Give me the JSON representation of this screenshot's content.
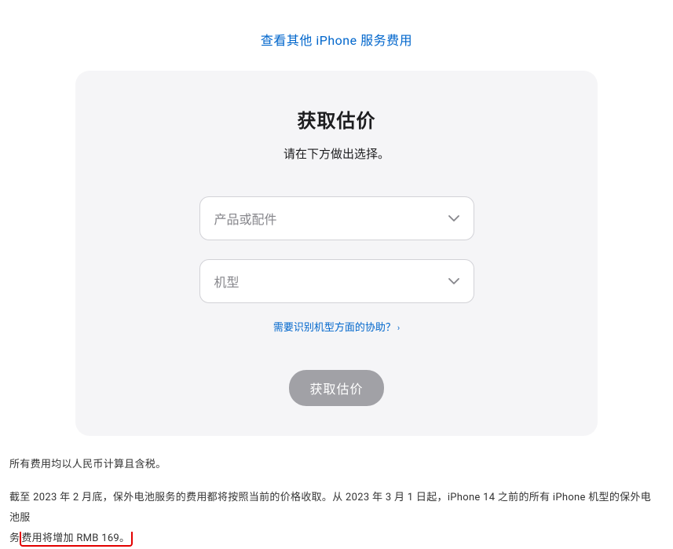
{
  "topLink": {
    "label": "查看其他 iPhone 服务费用"
  },
  "card": {
    "title": "获取估价",
    "subtitle": "请在下方做出选择。",
    "select1": {
      "placeholder": "产品或配件"
    },
    "select2": {
      "placeholder": "机型"
    },
    "helpLink": {
      "label": "需要识别机型方面的协助？"
    },
    "submitButton": {
      "label": "获取估价"
    }
  },
  "footer": {
    "line1": "所有费用均以人民币计算且含税。",
    "line2_part1": "截至 2023 年 2 月底，保外电池服务的费用都将按照当前的价格收取。从 2023 年 3 月 1 日起，iPhone 14 之前的所有 iPhone 机型的保外电池服",
    "line2_part2_prefix": "务",
    "line2_highlighted": "费用将增加 RMB 169。"
  }
}
